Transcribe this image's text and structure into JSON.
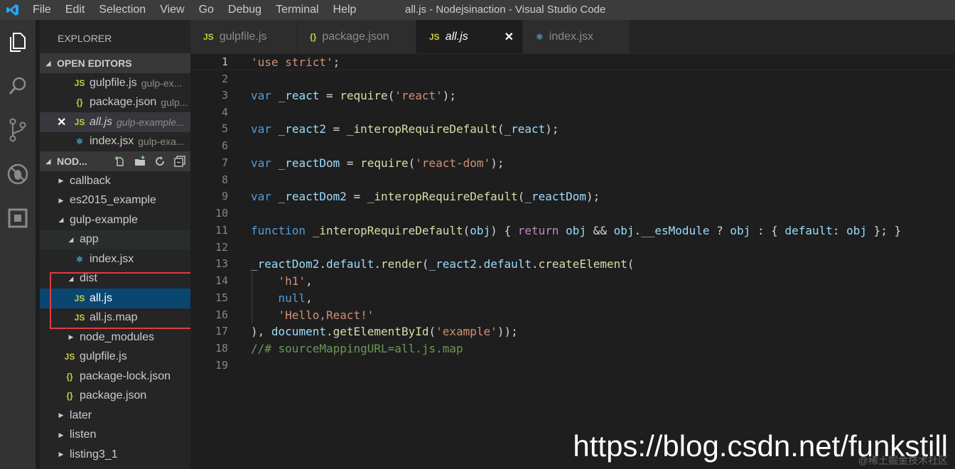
{
  "titlebar": {
    "menu": [
      "File",
      "Edit",
      "Selection",
      "View",
      "Go",
      "Debug",
      "Terminal",
      "Help"
    ],
    "title": "all.js - Nodejsinaction - Visual Studio Code"
  },
  "activity": [
    "explorer-icon",
    "search-icon",
    "source-control-icon",
    "debug-icon",
    "extensions-icon"
  ],
  "sidebar": {
    "title": "EXPLORER",
    "open_editors": {
      "label": "OPEN EDITORS",
      "items": [
        {
          "icon": "JS",
          "name": "gulpfile.js",
          "desc": "gulp-ex..."
        },
        {
          "icon": "{}",
          "name": "package.json",
          "desc": "gulp..."
        },
        {
          "icon": "JS",
          "name": "all.js",
          "desc": "gulp-example..."
        },
        {
          "icon": "react",
          "name": "index.jsx",
          "desc": "gulp-exa..."
        }
      ]
    },
    "folder": {
      "label": "NOD...",
      "tree": [
        {
          "name": "callback"
        },
        {
          "name": "es2015_example"
        },
        {
          "name": "gulp-example"
        },
        {
          "name": "app"
        },
        {
          "name": "index.jsx"
        },
        {
          "name": "dist"
        },
        {
          "name": "all.js"
        },
        {
          "name": "all.js.map"
        },
        {
          "name": "node_modules"
        },
        {
          "name": "gulpfile.js"
        },
        {
          "name": "package-lock.json"
        },
        {
          "name": "package.json"
        },
        {
          "name": "later"
        },
        {
          "name": "listen"
        },
        {
          "name": "listing3_1"
        }
      ]
    }
  },
  "tabs": [
    {
      "icon": "JS",
      "label": "gulpfile.js"
    },
    {
      "icon": "{}",
      "label": "package.json"
    },
    {
      "icon": "JS",
      "label": "all.js"
    },
    {
      "icon": "react",
      "label": "index.jsx"
    }
  ],
  "editor": {
    "line_numbers": [
      "1",
      "2",
      "3",
      "4",
      "5",
      "6",
      "7",
      "8",
      "9",
      "10",
      "11",
      "12",
      "13",
      "14",
      "15",
      "16",
      "17",
      "18",
      "19"
    ]
  },
  "watermark": "https://blog.csdn.net/funkstill",
  "watermark_small": "@稀土掘金技术社区",
  "colors": {
    "accent": "#007acc",
    "selection": "#094771",
    "highlight_box": "#e23c3c"
  }
}
